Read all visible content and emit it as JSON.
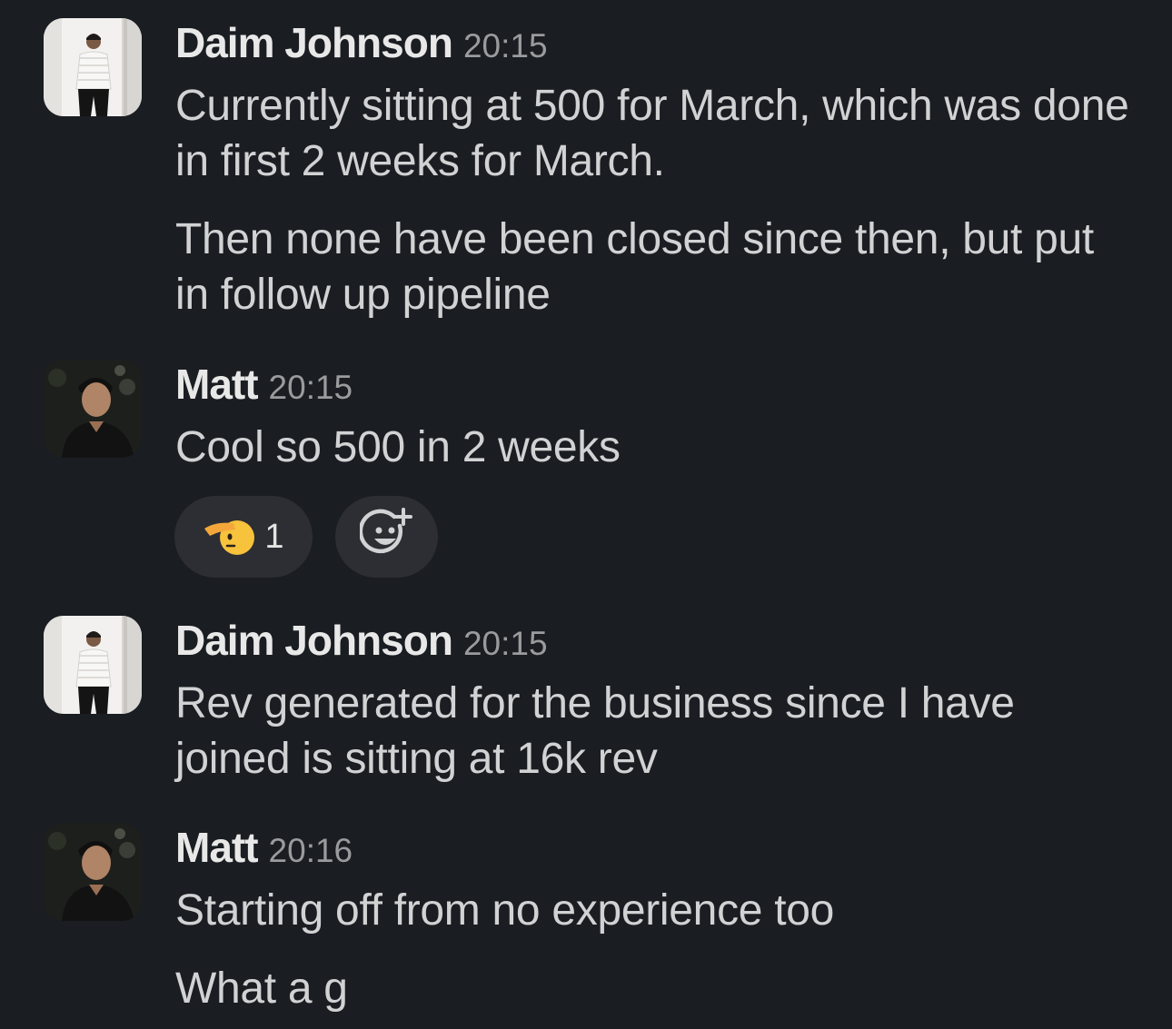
{
  "messages": [
    {
      "sender": "Daim Johnson",
      "time": "20:15",
      "paragraphs": [
        "Currently sitting at 500 for March, which was done in first 2 weeks for March.",
        "Then none have been closed since then, but put in follow up pipeline"
      ]
    },
    {
      "sender": "Matt",
      "time": "20:15",
      "paragraphs": [
        "Cool so 500 in 2 weeks"
      ],
      "reactions": [
        {
          "icon": "saluting-face-icon",
          "count": "1"
        }
      ]
    },
    {
      "sender": "Daim Johnson",
      "time": "20:15",
      "paragraphs": [
        "Rev generated for the business since I have joined is sitting at 16k rev"
      ]
    },
    {
      "sender": "Matt",
      "time": "20:16",
      "paragraphs": [
        "Starting off from no experience too",
        "What a g"
      ]
    }
  ],
  "add_reaction_icon": "add-reaction-icon",
  "colors": {
    "background": "#1a1d21",
    "sender": "#e8e8e8",
    "time": "#9a9b9d",
    "text": "#d1d2d3",
    "reaction_bg": "#2c2e33"
  }
}
